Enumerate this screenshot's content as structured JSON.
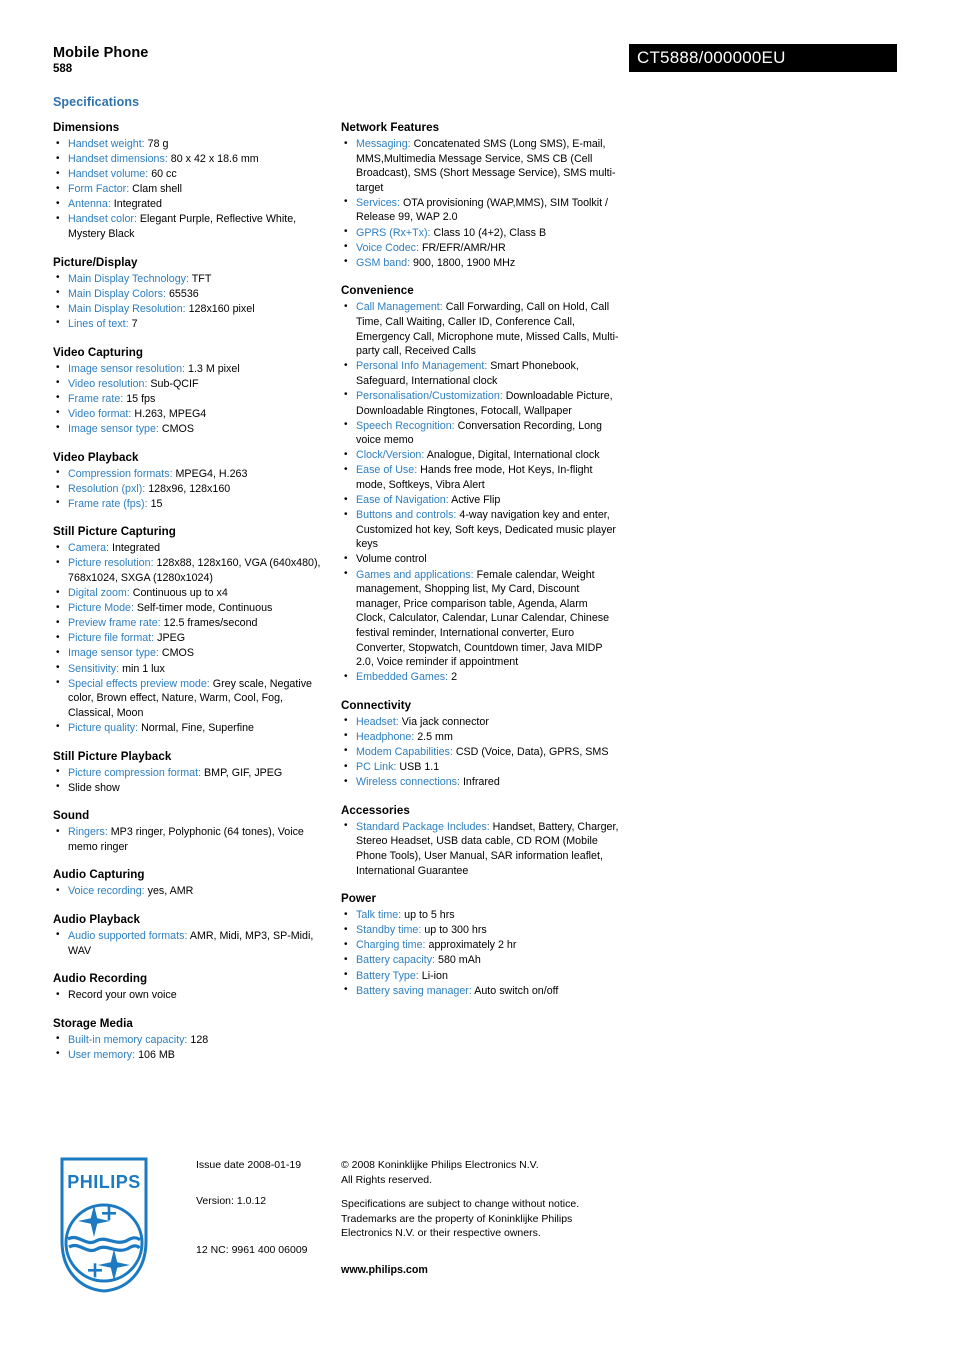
{
  "header": {
    "product_type": "Mobile Phone",
    "product_number": "588",
    "code": "CT5888/000000EU"
  },
  "specifications_title": "Specifications",
  "left_column": [
    {
      "title": "Dimensions",
      "items": [
        {
          "label": "Handset weight:",
          "value": "78 g"
        },
        {
          "label": "Handset dimensions:",
          "value": "80 x 42 x 18.6 mm"
        },
        {
          "label": "Handset volume:",
          "value": "60 cc"
        },
        {
          "label": "Form Factor:",
          "value": "Clam shell"
        },
        {
          "label": "Antenna:",
          "value": "Integrated"
        },
        {
          "label": "Handset color:",
          "value": "Elegant Purple, Reflective White, Mystery Black"
        }
      ]
    },
    {
      "title": "Picture/Display",
      "items": [
        {
          "label": "Main Display Technology:",
          "value": "TFT"
        },
        {
          "label": "Main Display Colors:",
          "value": "65536"
        },
        {
          "label": "Main Display Resolution:",
          "value": "128x160 pixel"
        },
        {
          "label": "Lines of text:",
          "value": "7"
        }
      ]
    },
    {
      "title": "Video Capturing",
      "items": [
        {
          "label": "Image sensor resolution:",
          "value": "1.3 M pixel"
        },
        {
          "label": "Video resolution:",
          "value": "Sub-QCIF"
        },
        {
          "label": "Frame rate:",
          "value": "15 fps"
        },
        {
          "label": "Video format:",
          "value": "H.263, MPEG4"
        },
        {
          "label": "Image sensor type:",
          "value": "CMOS"
        }
      ]
    },
    {
      "title": "Video Playback",
      "items": [
        {
          "label": "Compression formats:",
          "value": "MPEG4, H.263"
        },
        {
          "label": "Resolution (pxl):",
          "value": "128x96, 128x160"
        },
        {
          "label": "Frame rate (fps):",
          "value": "15"
        }
      ]
    },
    {
      "title": "Still Picture Capturing",
      "items": [
        {
          "label": "Camera:",
          "value": "Integrated"
        },
        {
          "label": "Picture resolution:",
          "value": "128x88, 128x160, VGA (640x480), 768x1024, SXGA (1280x1024)"
        },
        {
          "label": "Digital zoom:",
          "value": "Continuous up to x4"
        },
        {
          "label": "Picture Mode:",
          "value": "Self-timer mode, Continuous"
        },
        {
          "label": "Preview frame rate:",
          "value": "12.5 frames/second"
        },
        {
          "label": "Picture file format:",
          "value": "JPEG"
        },
        {
          "label": "Image sensor type:",
          "value": "CMOS"
        },
        {
          "label": "Sensitivity:",
          "value": "min 1 lux"
        },
        {
          "label": "Special effects preview mode:",
          "value": "Grey scale, Negative color, Brown effect, Nature, Warm, Cool, Fog, Classical, Moon"
        },
        {
          "label": "Picture quality:",
          "value": "Normal, Fine, Superfine"
        }
      ]
    },
    {
      "title": "Still Picture Playback",
      "items": [
        {
          "label": "Picture compression format:",
          "value": "BMP, GIF, JPEG"
        },
        {
          "label": "",
          "value": "Slide show"
        }
      ]
    },
    {
      "title": "Sound",
      "items": [
        {
          "label": "Ringers:",
          "value": "MP3 ringer, Polyphonic (64 tones), Voice memo ringer"
        }
      ]
    },
    {
      "title": "Audio Capturing",
      "items": [
        {
          "label": "Voice recording:",
          "value": "yes, AMR"
        }
      ]
    },
    {
      "title": "Audio Playback",
      "items": [
        {
          "label": "Audio supported formats:",
          "value": "AMR, Midi, MP3, SP-Midi, WAV"
        }
      ]
    },
    {
      "title": "Audio Recording",
      "items": [
        {
          "label": "",
          "value": "Record your own voice"
        }
      ]
    },
    {
      "title": "Storage Media",
      "items": [
        {
          "label": "Built-in memory capacity:",
          "value": "128"
        },
        {
          "label": "User memory:",
          "value": "106 MB"
        }
      ]
    }
  ],
  "right_column": [
    {
      "title": "Network Features",
      "items": [
        {
          "label": "Messaging:",
          "value": "Concatenated SMS (Long SMS), E-mail, MMS,Multimedia Message Service, SMS CB (Cell Broadcast), SMS (Short Message Service), SMS multi-target"
        },
        {
          "label": "Services:",
          "value": "OTA provisioning (WAP,MMS), SIM Toolkit / Release 99, WAP 2.0"
        },
        {
          "label": "GPRS (Rx+Tx):",
          "value": "Class 10 (4+2), Class B"
        },
        {
          "label": "Voice Codec:",
          "value": "FR/EFR/AMR/HR"
        },
        {
          "label": "GSM band:",
          "value": "900, 1800, 1900 MHz"
        }
      ]
    },
    {
      "title": "Convenience",
      "items": [
        {
          "label": "Call Management:",
          "value": "Call Forwarding, Call on Hold, Call Time, Call Waiting, Caller ID, Conference Call, Emergency Call, Microphone mute, Missed Calls, Multi-party call, Received Calls"
        },
        {
          "label": "Personal Info Management:",
          "value": "Smart Phonebook, Safeguard, International clock"
        },
        {
          "label": "Personalisation/Customization:",
          "value": "Downloadable Picture, Downloadable Ringtones, Fotocall, Wallpaper"
        },
        {
          "label": "Speech Recognition:",
          "value": "Conversation Recording, Long voice memo"
        },
        {
          "label": "Clock/Version:",
          "value": "Analogue, Digital, International clock"
        },
        {
          "label": "Ease of Use:",
          "value": "Hands free mode, Hot Keys, In-flight mode, Softkeys, Vibra Alert"
        },
        {
          "label": "Ease of Navigation:",
          "value": "Active Flip"
        },
        {
          "label": "Buttons and controls:",
          "value": "4-way navigation key and enter, Customized hot key, Soft keys, Dedicated music player keys"
        },
        {
          "label": "",
          "value": "Volume control"
        },
        {
          "label": "Games and applications:",
          "value": "Female calendar, Weight management, Shopping list, My Card, Discount manager, Price comparison table, Agenda, Alarm Clock, Calculator, Calendar, Lunar Calendar, Chinese festival reminder, International converter, Euro Converter, Stopwatch, Countdown timer, Java MIDP 2.0, Voice reminder if appointment"
        },
        {
          "label": "Embedded Games:",
          "value": "2"
        }
      ]
    },
    {
      "title": "Connectivity",
      "items": [
        {
          "label": "Headset:",
          "value": "Via jack connector"
        },
        {
          "label": "Headphone:",
          "value": "2.5 mm"
        },
        {
          "label": "Modem Capabilities:",
          "value": "CSD (Voice, Data), GPRS, SMS"
        },
        {
          "label": "PC Link:",
          "value": "USB 1.1"
        },
        {
          "label": "Wireless connections:",
          "value": "Infrared"
        }
      ]
    },
    {
      "title": "Accessories",
      "items": [
        {
          "label": "Standard Package Includes:",
          "value": "Handset, Battery, Charger, Stereo Headset, USB data cable, CD ROM (Mobile Phone Tools), User Manual, SAR information leaflet, International Guarantee"
        }
      ]
    },
    {
      "title": "Power",
      "items": [
        {
          "label": "Talk time:",
          "value": "up to 5 hrs"
        },
        {
          "label": "Standby time:",
          "value": "up to 300 hrs"
        },
        {
          "label": "Charging time:",
          "value": "approximately 2 hr"
        },
        {
          "label": "Battery capacity:",
          "value": "580 mAh"
        },
        {
          "label": "Battery Type:",
          "value": "Li-ion"
        },
        {
          "label": "Battery saving manager:",
          "value": "Auto switch on/off"
        }
      ]
    }
  ],
  "footer": {
    "logo_wordmark": "PHILIPS",
    "issue_date": "Issue date 2008-01-19",
    "version": "Version: 1.0.12",
    "nc_code": "12 NC: 9961 400 06009",
    "copyright_line1": "© 2008 Koninklijke Philips Electronics N.V.",
    "copyright_line2": "All Rights reserved.",
    "disclaimer_line1": "Specifications are subject to change without notice.",
    "disclaimer_line2": "Trademarks are the property of Koninklijke Philips",
    "disclaimer_line3": "Electronics N.V. or their respective owners.",
    "website": "www.philips.com"
  },
  "colors": {
    "label_blue": "#2f7fc0",
    "heading_blue": "#2f72ad",
    "logo_blue": "#1b7ac1",
    "code_bar_bg": "#000000"
  }
}
